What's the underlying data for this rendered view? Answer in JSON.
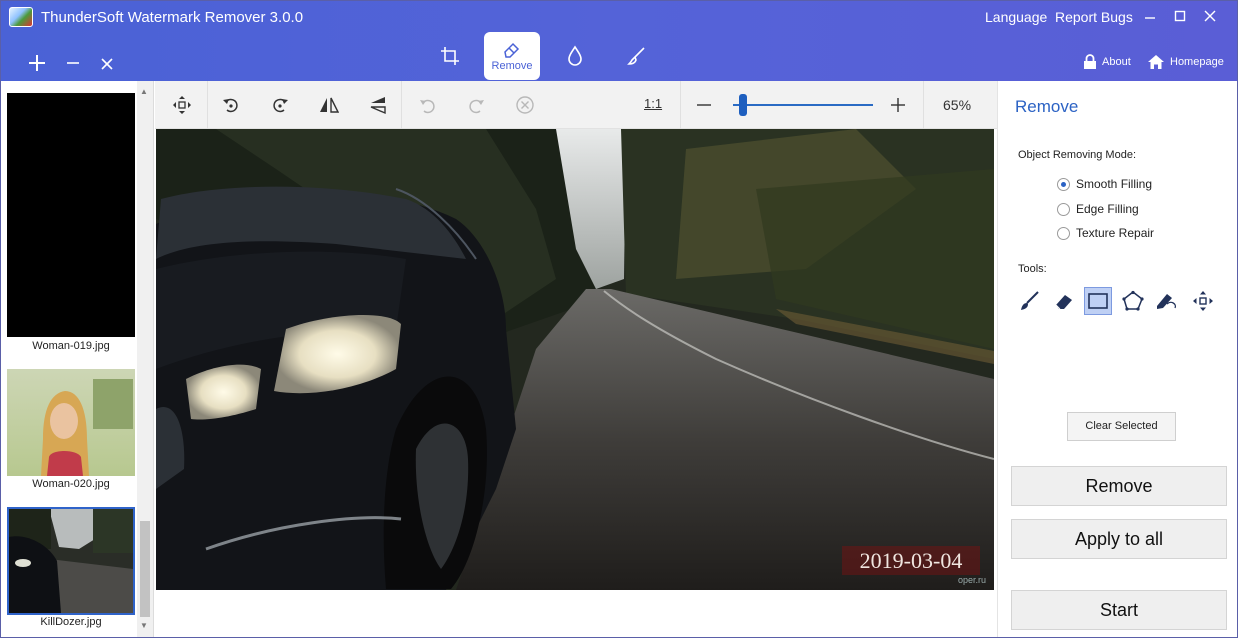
{
  "window": {
    "title": "ThunderSoft Watermark Remover 3.0.0",
    "language_label": "Language",
    "report_bugs_label": "Report Bugs"
  },
  "mode_tabs": {
    "remove_label": "Remove"
  },
  "header_links": {
    "about_label": "About",
    "homepage_label": "Homepage"
  },
  "thumbnails": [
    {
      "label": "Woman-019.jpg"
    },
    {
      "label": "Woman-020.jpg"
    },
    {
      "label": "KillDozer.jpg"
    }
  ],
  "toolbar": {
    "ratio_label": "1:1",
    "zoom_level": "65%"
  },
  "image": {
    "watermark_text": "2019-03-04",
    "credit_text": "oper.ru"
  },
  "panel": {
    "title": "Remove",
    "mode_heading": "Object Removing Mode:",
    "modes": [
      {
        "label": "Smooth Filling",
        "selected": true
      },
      {
        "label": "Edge Filling",
        "selected": false
      },
      {
        "label": "Texture Repair",
        "selected": false
      }
    ],
    "tools_heading": "Tools:",
    "active_tool": "rectangle-select-icon",
    "clear_selected_label": "Clear Selected",
    "remove_label": "Remove",
    "apply_all_label": "Apply to all",
    "start_label": "Start"
  },
  "colors": {
    "header_bg": "#4a62d6",
    "accent": "#2b62c4",
    "active_tool_bg": "#bfd0f4"
  }
}
